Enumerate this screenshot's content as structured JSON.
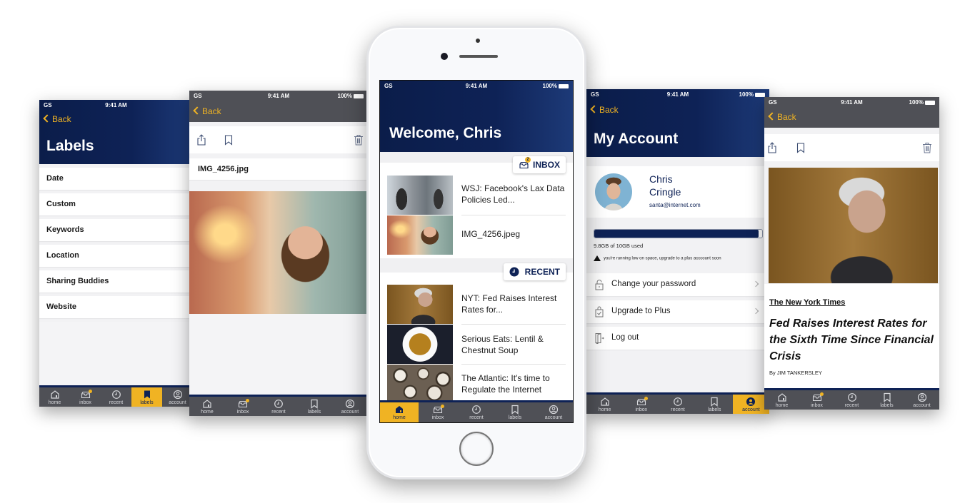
{
  "status_bar": {
    "carrier": "GS",
    "time": "9:41 AM",
    "battery": "100%"
  },
  "nav": {
    "back_label": "Back"
  },
  "tabs": [
    {
      "id": "home",
      "label": "home"
    },
    {
      "id": "inbox",
      "label": "inbox"
    },
    {
      "id": "recent",
      "label": "recent"
    },
    {
      "id": "labels",
      "label": "labels"
    },
    {
      "id": "account",
      "label": "account"
    }
  ],
  "labels_screen": {
    "title": "Labels",
    "active_tab": "labels",
    "items": [
      "Date",
      "Custom",
      "Keywords",
      "Location",
      "Sharing Buddies",
      "Website"
    ]
  },
  "photo_screen": {
    "file_name": "IMG_4256.jpg",
    "actions": [
      "share",
      "bookmark",
      "delete"
    ]
  },
  "home_screen": {
    "title": "Welcome, Chris",
    "active_tab": "home",
    "inbox": {
      "label": "INBOX",
      "badge": "2",
      "items": [
        {
          "title": "WSJ: Facebook's Lax Data Policies Led..."
        },
        {
          "title": "IMG_4256.jpeg"
        }
      ]
    },
    "recent": {
      "label": "RECENT",
      "items": [
        {
          "title": "NYT: Fed Raises Interest Rates for..."
        },
        {
          "title": "Serious Eats: Lentil & Chestnut Soup"
        },
        {
          "title": "The Atlantic: It's time to Regulate the Internet"
        }
      ]
    }
  },
  "account_screen": {
    "title": "My Account",
    "active_tab": "account",
    "user": {
      "first_name": "Chris",
      "last_name": "Cringle",
      "email": "santa@internet.com"
    },
    "storage": {
      "used_fraction": 0.98,
      "text": "9.8GB of 10GB used",
      "warning": "you're running low on space, upgrade to a plus acccount soon"
    },
    "menu": [
      {
        "label": "Change your password",
        "icon": "lock-icon",
        "chevron": true
      },
      {
        "label": "Upgrade to Plus",
        "icon": "upgrade-bag-icon",
        "chevron": true
      },
      {
        "label": "Log out",
        "icon": "logout-door-icon",
        "chevron": false
      }
    ]
  },
  "article_screen": {
    "source": "The New York Times",
    "headline": "Fed Raises Interest Rates for the Sixth Time Since Financial Crisis",
    "byline": "By JIM TANKERSLEY"
  },
  "colors": {
    "navy": "#0e2256",
    "gold": "#f0b323",
    "tabbar": "#4f5056"
  }
}
